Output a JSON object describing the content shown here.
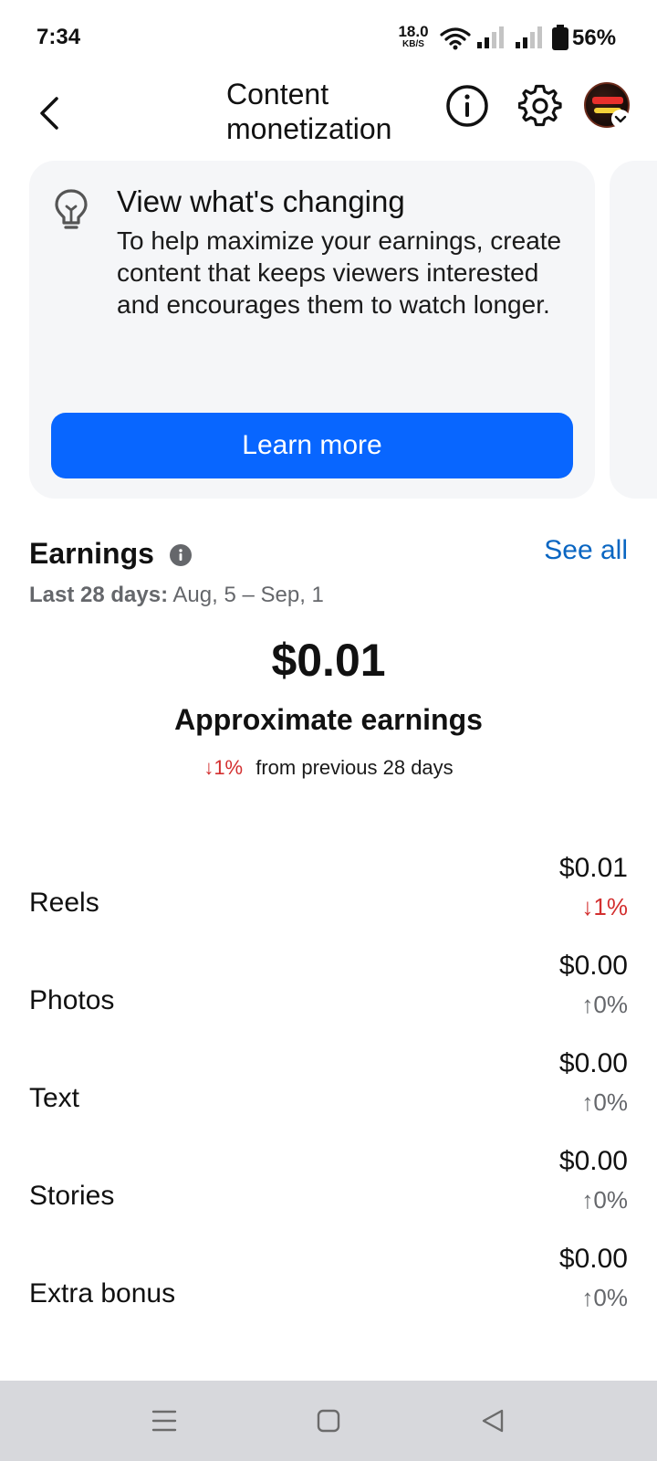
{
  "status_bar": {
    "time": "7:34",
    "net_speed": "18.0",
    "net_unit": "KB/S",
    "battery": "56%",
    "icons": [
      "wifi-icon",
      "signal-icon",
      "signal-icon",
      "battery-icon"
    ]
  },
  "header": {
    "title": "Content monetization",
    "icons": [
      "back-arrow-icon",
      "info-icon",
      "gear-icon",
      "avatar"
    ]
  },
  "promo": {
    "title": "View what's changing",
    "body": "To help maximize your earnings, create content that keeps viewers interested and encourages them to watch longer.",
    "button_label": "Learn more",
    "icon": "lightbulb-icon",
    "button_color": "#0866ff"
  },
  "earnings": {
    "title": "Earnings",
    "see_all": "See all",
    "date_prefix": "Last 28 days:",
    "date_range": "Aug, 5 – Sep, 1",
    "total": "$0.01",
    "total_label": "Approximate earnings",
    "total_change": "↓1%",
    "total_change_suffix": "from previous 28 days",
    "rows": [
      {
        "label": "Reels",
        "amount": "$0.01",
        "change": "↓1%"
      },
      {
        "label": "Photos",
        "amount": "$0.00",
        "change": "↑0%"
      },
      {
        "label": "Text",
        "amount": "$0.00",
        "change": "↑0%"
      },
      {
        "label": "Stories",
        "amount": "$0.00",
        "change": "↑0%"
      },
      {
        "label": "Extra bonus",
        "amount": "$0.00",
        "change": "↑0%"
      }
    ]
  },
  "colors": {
    "accent": "#0866ff",
    "link": "#0a66c2",
    "decline": "#d32f2f",
    "neutral": "#65676b"
  },
  "nav_bar": {
    "icons": [
      "menu-icon",
      "home-square-icon",
      "back-triangle-icon"
    ]
  }
}
